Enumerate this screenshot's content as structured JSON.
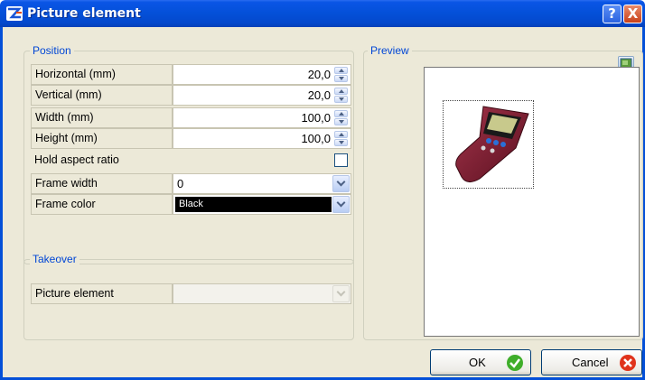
{
  "window": {
    "title": "Picture element",
    "help_label": "?",
    "close_label": "X"
  },
  "position_group": {
    "legend": "Position",
    "rows": [
      {
        "label": "Horizontal  (mm)",
        "value": "20,0"
      },
      {
        "label": "Vertical (mm)",
        "value": "20,0"
      },
      {
        "label": "Width (mm)",
        "value": "100,0"
      },
      {
        "label": "Height (mm)",
        "value": "100,0"
      }
    ],
    "hold_aspect_ratio": {
      "label": "Hold aspect ratio",
      "checked": false
    },
    "frame_width": {
      "label": "Frame width",
      "value": "0"
    },
    "frame_color": {
      "label": "Frame color",
      "value": "Black",
      "swatch": "#000000"
    }
  },
  "takeover_group": {
    "legend": "Takeover",
    "picture_element": {
      "label": "Picture element",
      "value": ""
    }
  },
  "preview_group": {
    "legend": "Preview"
  },
  "buttons": {
    "ok": "OK",
    "cancel": "Cancel"
  },
  "colors": {
    "titlebar": "#0450d8",
    "legend_text": "#0046d5",
    "dialog_bg": "#ece9d8",
    "ok_icon": "#3fae2a",
    "cancel_icon": "#e0331b"
  }
}
